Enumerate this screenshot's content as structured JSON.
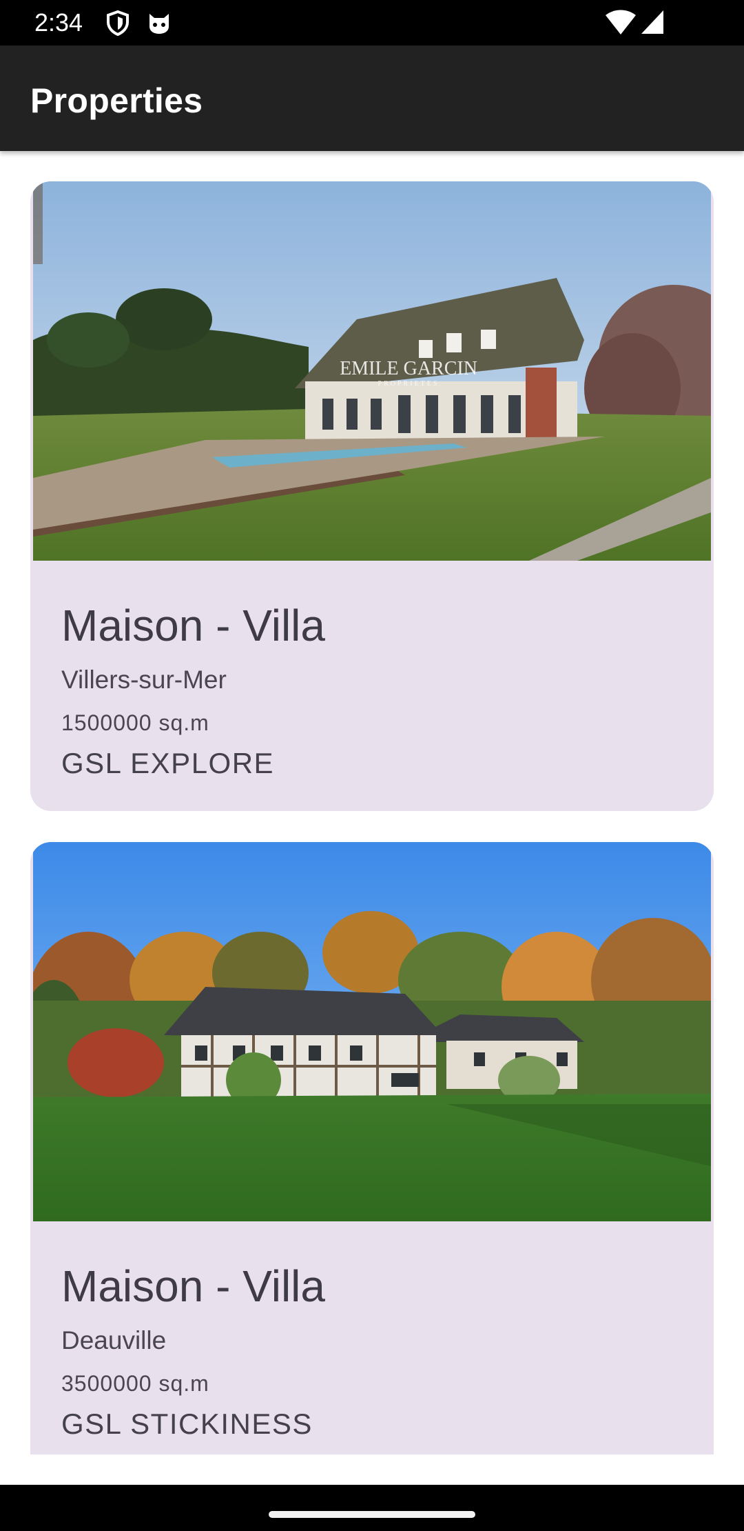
{
  "status_bar": {
    "time": "2:34",
    "icons": [
      "shield-icon",
      "cat-face-icon",
      "wifi-icon",
      "cell-signal-icon"
    ]
  },
  "app_bar": {
    "title": "Properties"
  },
  "colors": {
    "status_bar": "#000000",
    "app_bar": "#222222",
    "card_background": "#e8e0ec",
    "text_primary": "#3f3a47"
  },
  "properties": [
    {
      "title": "Maison - Villa",
      "city": "Villers-sur-Mer",
      "area": "1500000 sq.m",
      "tag": "GSL EXPLORE",
      "photo_watermark": "EMILE GARCIN",
      "photo_watermark_sub": "PROPRIETES"
    },
    {
      "title": "Maison - Villa",
      "city": "Deauville",
      "area": "3500000 sq.m",
      "tag": "GSL STICKINESS"
    }
  ]
}
